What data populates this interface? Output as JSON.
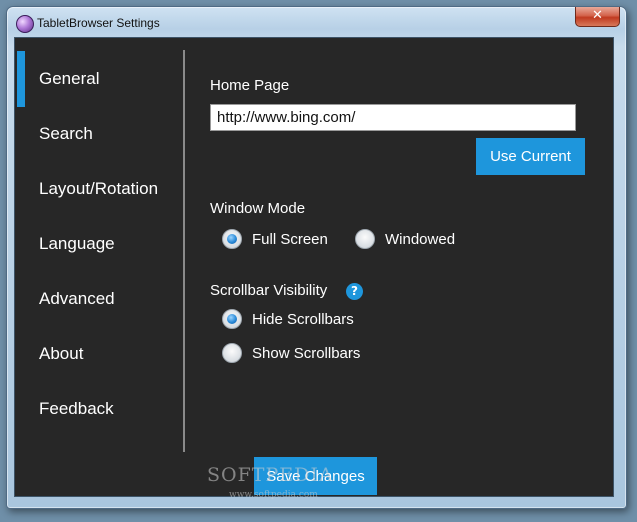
{
  "window": {
    "title": "TabletBrowser Settings",
    "close_glyph": "✕"
  },
  "sidebar": {
    "items": [
      {
        "label": "General",
        "active": true
      },
      {
        "label": "Search"
      },
      {
        "label": "Layout/Rotation"
      },
      {
        "label": "Language"
      },
      {
        "label": "Advanced"
      },
      {
        "label": "About"
      },
      {
        "label": "Feedback"
      }
    ]
  },
  "general": {
    "home_page_label": "Home Page",
    "home_page_value": "http://www.bing.com/",
    "use_current_label": "Use Current",
    "window_mode_label": "Window Mode",
    "window_mode_options": [
      {
        "label": "Full Screen",
        "checked": true
      },
      {
        "label": "Windowed",
        "checked": false
      }
    ],
    "scrollbar_label": "Scrollbar Visibility",
    "help_glyph": "?",
    "scrollbar_options": [
      {
        "label": "Hide Scrollbars",
        "checked": true
      },
      {
        "label": "Show Scrollbars",
        "checked": false
      }
    ],
    "save_label": "Save Changes"
  },
  "watermark": {
    "main": "SOFTPEDIA",
    "url": "www.softpedia.com"
  },
  "colors": {
    "accent": "#1e96dc",
    "background": "#272727"
  }
}
